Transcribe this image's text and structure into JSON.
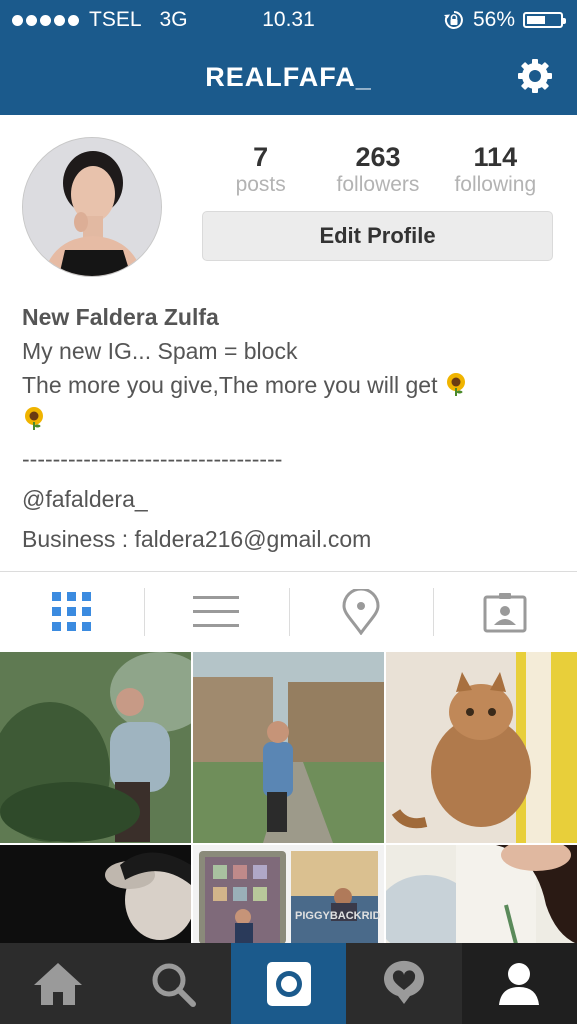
{
  "status_bar": {
    "carrier": "TSEL",
    "network": "3G",
    "time": "10.31",
    "battery_text": "56%",
    "battery_level": 0.56
  },
  "header": {
    "username": "REALFAFA_"
  },
  "profile": {
    "stats": [
      {
        "value": "7",
        "label": "posts"
      },
      {
        "value": "263",
        "label": "followers"
      },
      {
        "value": "114",
        "label": "following"
      }
    ],
    "edit_label": "Edit Profile",
    "name": "New Faldera Zulfa",
    "bio_line1": "My new IG... Spam = block",
    "bio_line2": "The more you give,The more you will get",
    "bio_dashes": "----------------------------------",
    "bio_handle": "@fafaldera_",
    "bio_business": "Business : faldera216@gmail.com"
  },
  "tabs": [
    "grid-icon",
    "list-icon",
    "location-pin-icon",
    "tagged-photos-icon"
  ],
  "bottom_nav": [
    "home-icon",
    "search-icon",
    "camera-icon",
    "activity-icon",
    "profile-icon"
  ],
  "grid_overlay_text": "PIGGYBACKRID",
  "colors": {
    "brand": "#1b5a8c",
    "tab_active": "#3b8be0",
    "tab_inactive": "#9a9a9a",
    "bottom_bar": "#2c2c2c"
  }
}
